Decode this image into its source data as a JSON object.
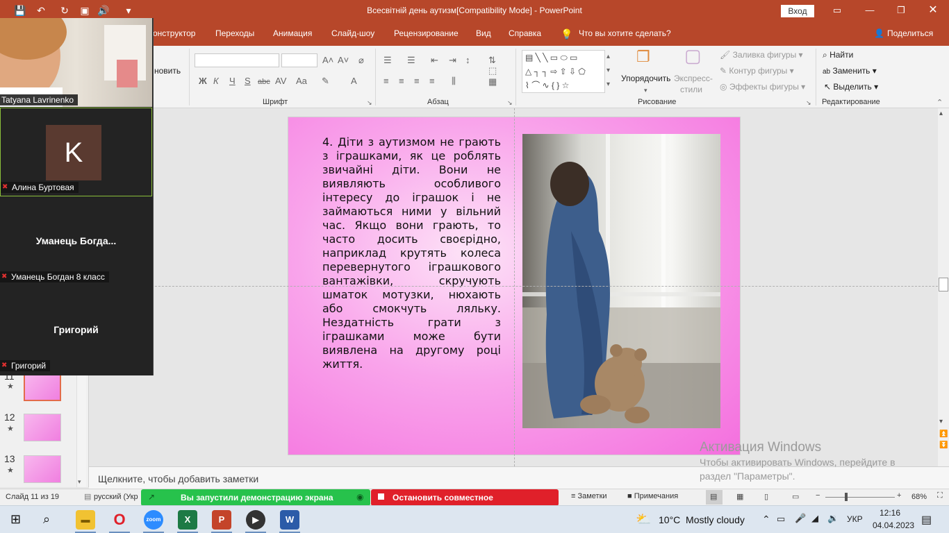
{
  "window": {
    "title": "Всесвітній день аутизм[Compatibility Mode] - PowerPoint",
    "login_button": "Вход"
  },
  "ribbon_tabs": [
    "онструктор",
    "Переходы",
    "Анимация",
    "Слайд-шоу",
    "Рецензирование",
    "Вид",
    "Справка"
  ],
  "tell_me": "Что вы хотите сделать?",
  "share": "Поделиться",
  "ribbon": {
    "left_cut": "новить",
    "font_group": "Шрифт",
    "paragraph_group": "Абзац",
    "drawing_group": "Рисование",
    "editing_group": "Редактирование",
    "arrange": "Упорядочить",
    "quick_styles_1": "Экспресс-",
    "quick_styles_2": "стили",
    "shape_fill": "Заливка фигуры",
    "shape_outline": "Контур фигуры",
    "shape_effects": "Эффекты фигуры",
    "find": "Найти",
    "replace": "Заменить",
    "select": "Выделить"
  },
  "slide": {
    "text": "4. Діти з аутизмом не грають з іграшками, як це роблять звичайні діти. Вони не виявляють особливого інтересу до іграшок і не займаються ними у вільний час. Якщо вони грають, то часто досить своєрідно, наприклад крутять колеса перевернутого іграшкового вантажівки, скручують шматок мотузки, нюхають або смокчуть ляльку. Нездатність грати з іграшками може бути виявлена на другому році життя."
  },
  "thumbnails": [
    {
      "num": "11",
      "sel": true
    },
    {
      "num": "12"
    },
    {
      "num": "13"
    }
  ],
  "notes_placeholder": "Щелкните, чтобы добавить заметки",
  "watermark": {
    "title": "Активация Windows",
    "line1": "Чтобы активировать Windows, перейдите в",
    "line2": "раздел \"Параметры\"."
  },
  "status": {
    "slide_of": "Слайд 11 из 19",
    "language": "русский (Укр",
    "sharing": "Вы запустили демонстрацию экрана",
    "stop_sharing": "Остановить совместное использование",
    "notes": "Заметки",
    "comments": "Примечания",
    "zoom": "68%"
  },
  "zoom_participants": {
    "p1": "Tatyana Lavrinenko",
    "p2": "Алина Буртовая",
    "p2_initial": "K",
    "p3_big": "Уманець  Богда...",
    "p3": "Уманець Богдан 8 класс",
    "p4_big": "Григорий",
    "p4": "Григорий"
  },
  "taskbar": {
    "weather": "10°C  Mostly cloudy",
    "lang": "УКР",
    "time": "12:16",
    "date": "04.04.2023"
  },
  "colors": {
    "accent": "#b7472a",
    "slide_pink": "#f46fde",
    "share_green": "#27c24c",
    "stop_red": "#e0202a"
  }
}
